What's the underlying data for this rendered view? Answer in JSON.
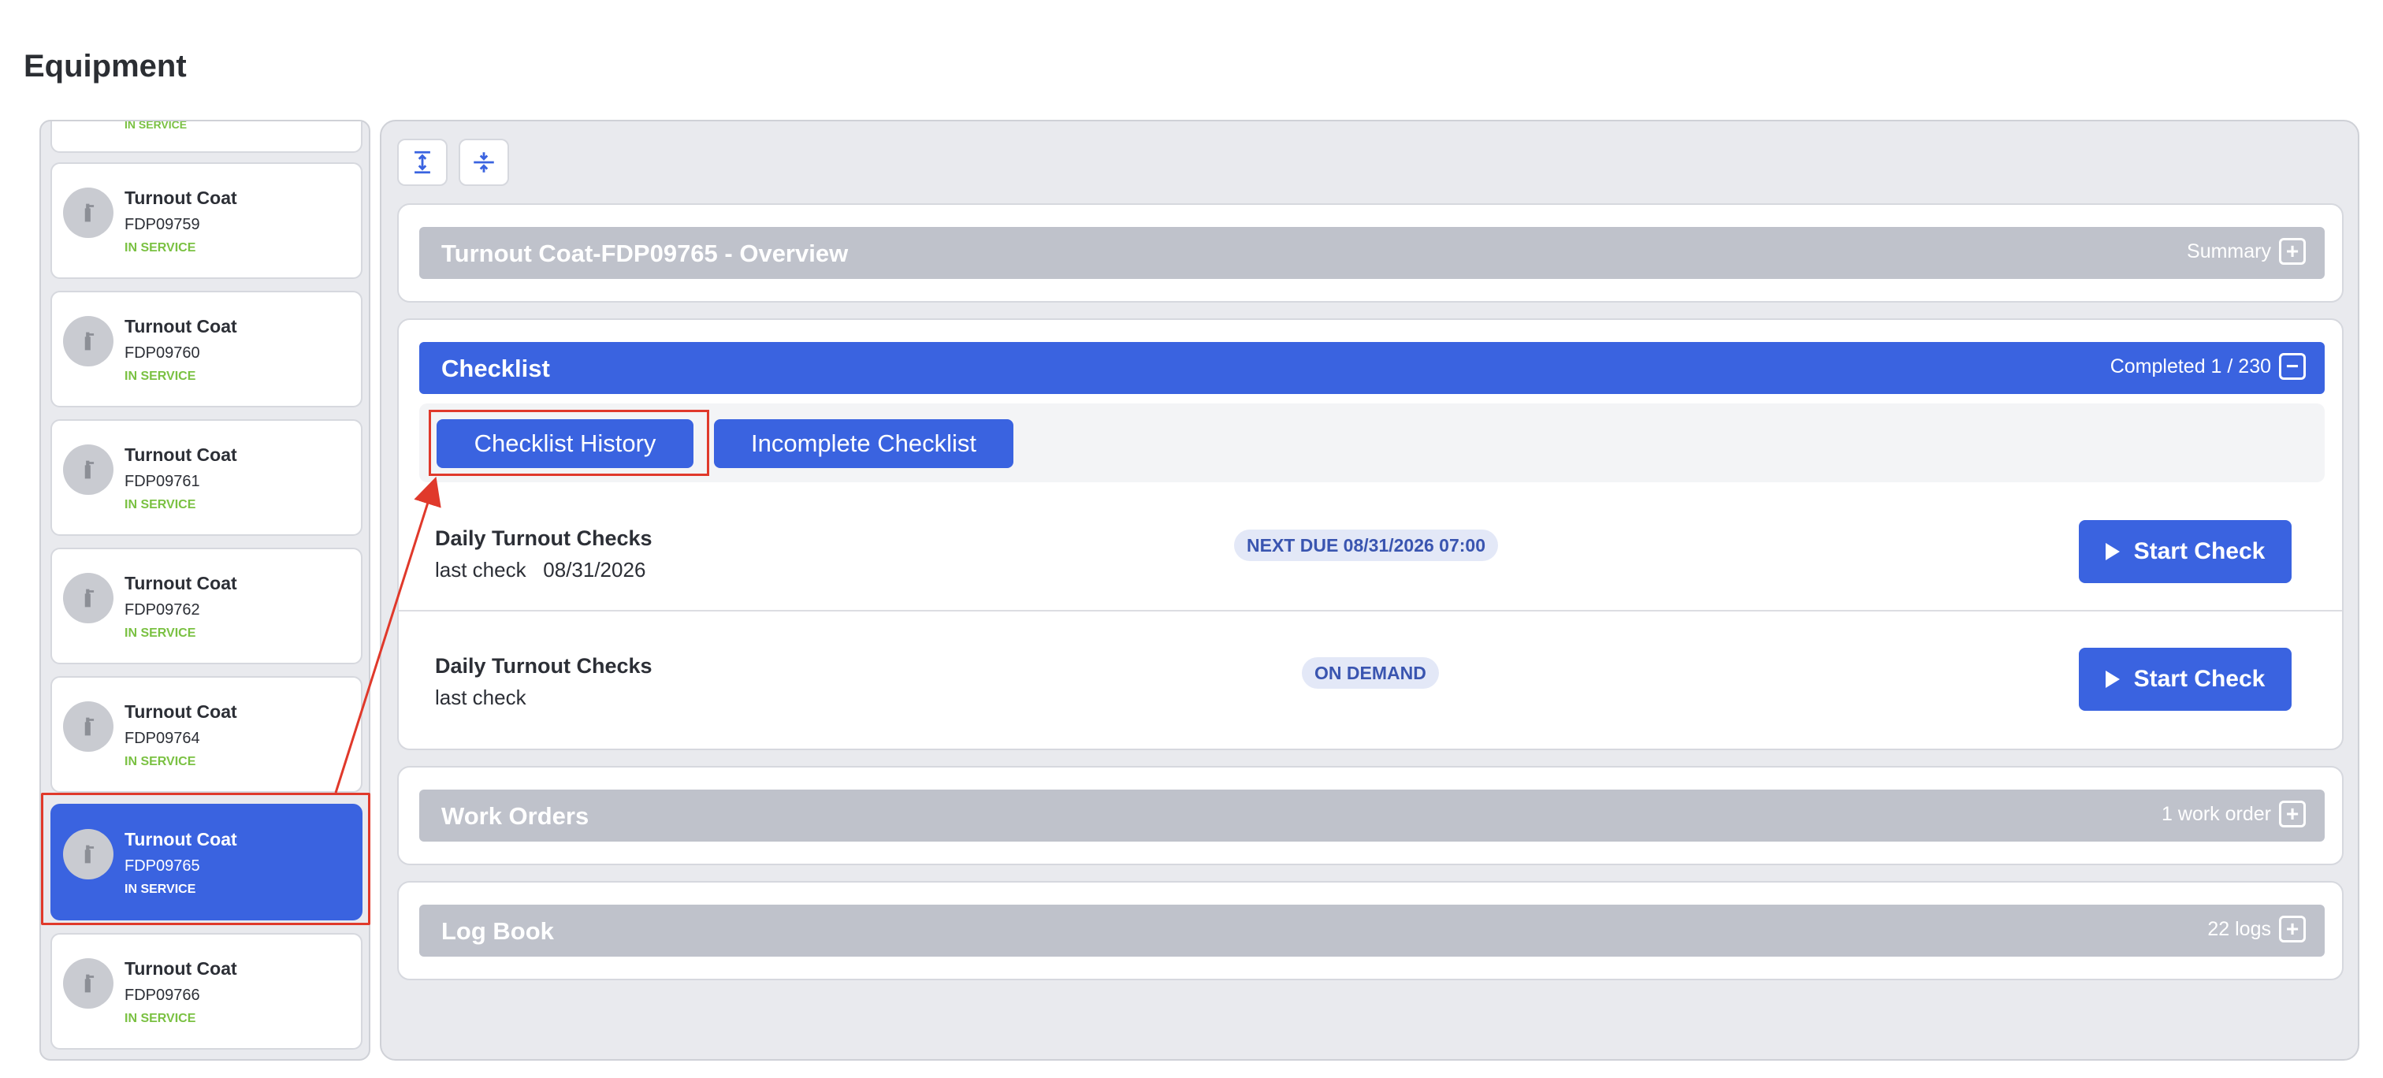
{
  "page": {
    "title": "Equipment"
  },
  "sidebar": {
    "items": [
      {
        "name": "",
        "code": "",
        "status": "IN SERVICE"
      },
      {
        "name": "Turnout Coat",
        "code": "FDP09759",
        "status": "IN SERVICE"
      },
      {
        "name": "Turnout Coat",
        "code": "FDP09760",
        "status": "IN SERVICE"
      },
      {
        "name": "Turnout Coat",
        "code": "FDP09761",
        "status": "IN SERVICE"
      },
      {
        "name": "Turnout Coat",
        "code": "FDP09762",
        "status": "IN SERVICE"
      },
      {
        "name": "Turnout Coat",
        "code": "FDP09764",
        "status": "IN SERVICE"
      },
      {
        "name": "Turnout Coat",
        "code": "FDP09765",
        "status": "IN SERVICE",
        "selected": true
      },
      {
        "name": "Turnout Coat",
        "code": "FDP09766",
        "status": "IN SERVICE"
      }
    ],
    "status_color": "#7ac142",
    "selected_color": "#3a63e0"
  },
  "toolbar": {
    "expand_icon": "expand-all-icon",
    "collapse_icon": "collapse-all-icon"
  },
  "overview": {
    "title": "Turnout Coat-FDP09765 - Overview",
    "right_label": "Summary",
    "toggle": "+"
  },
  "checklist": {
    "title": "Checklist",
    "right_label": "Completed 1 / 230",
    "toggle": "−",
    "history_button": "Checklist History",
    "incomplete_button": "Incomplete Checklist",
    "rows": [
      {
        "name": "Daily Turnout Checks",
        "last_check": "last check   08/31/2026",
        "badge": "NEXT DUE 08/31/2026 07:00",
        "button": "Start Check"
      },
      {
        "name": "Daily Turnout Checks",
        "last_check": "last check",
        "badge": "ON DEMAND",
        "button": "Start Check"
      }
    ]
  },
  "work_orders": {
    "title": "Work Orders",
    "right_label": "1 work order",
    "toggle": "+"
  },
  "log_book": {
    "title": "Log Book",
    "right_label": "22 logs",
    "toggle": "+"
  },
  "colors": {
    "accent": "#3a63e0",
    "highlight": "#e0392b",
    "section_gray": "#bfc2cb"
  }
}
